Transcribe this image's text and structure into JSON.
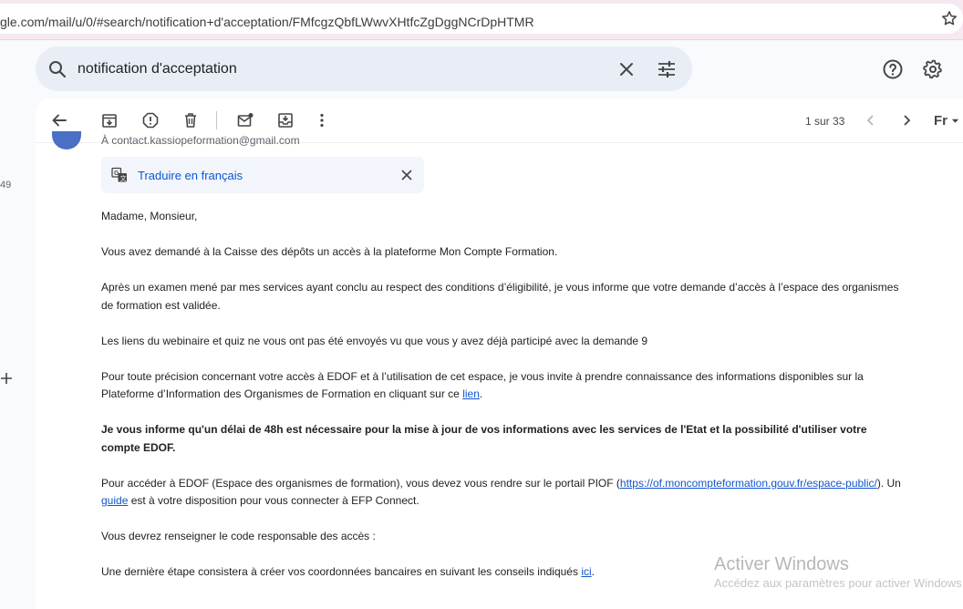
{
  "browser": {
    "url": "gle.com/mail/u/0/#search/notification+d'acceptation/FMfcgzQbfLWwvXHtfcZgDggNCrDpHTMR"
  },
  "left_rail": {
    "count_text": "49"
  },
  "search": {
    "value": "notification d'acceptation"
  },
  "toolbar": {
    "pager_text": "1 sur 33",
    "language_label": "Fr"
  },
  "message": {
    "sender": "À contact.kassiopeformation@gmail.com",
    "translate_label": "Traduire en français",
    "p1": "Madame, Monsieur,",
    "p2": "Vous avez demandé à la Caisse des dépôts un accès à la plateforme Mon Compte Formation.",
    "p3_line1": "Après un examen mené par mes services ayant conclu au respect des conditions d’éligibilité, je vous informe que votre demande d’accès à l’espace des organismes",
    "p3_line2": "de formation est validée.",
    "p4": "Les liens du webinaire et quiz ne vous ont pas été envoyés vu que vous y avez déjà participé avec la demande 9",
    "p5_line1": "Pour toute précision concernant votre accès à EDOF et à l’utilisation de cet espace, je vous invite à prendre connaissance des informations disponibles sur la",
    "p5_line2_prefix": "Plateforme d’Information des Organismes de Formation en cliquant sur ce ",
    "p5_link": "lien",
    "p5_suffix": ".",
    "p6_line1": "Je vous informe qu'un délai de 48h est nécessaire pour la mise à jour de vos informations avec les services de l'Etat et la possibilité d'utiliser votre",
    "p6_line2": "compte EDOF.",
    "p7_line1_prefix": "Pour accéder à EDOF (Espace des organismes de formation), vous devez vous rendre sur le portail PIOF (",
    "p7_link": "https://of.moncompteformation.gouv.fr/espace-public/",
    "p7_line1_suffix": "). Un",
    "p7_guide": "guide",
    "p7_line2_suffix": " est à votre disposition pour vous connecter à EFP Connect.",
    "p8": "Vous devrez renseigner le code responsable des accès :",
    "p9_prefix": "Une dernière étape consistera à créer vos coordonnées bancaires en suivant les conseils indiqués ",
    "p9_link": "ici",
    "p9_suffix": "."
  },
  "watermark": {
    "title": "Activer Windows",
    "subtitle": "Accédez aux paramètres pour activer Windows."
  }
}
